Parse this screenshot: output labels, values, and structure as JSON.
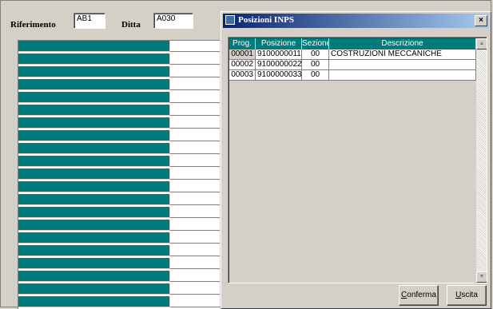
{
  "header": {
    "riferimento_label": "Riferimento",
    "riferimento_value": "AB1",
    "ditta_label": "Ditta",
    "ditta_value": "A030"
  },
  "dialog": {
    "title": "Posizioni INPS",
    "close_glyph": "×",
    "columns": [
      "Prog.",
      "Posizione",
      "Sezione",
      "Descrizione"
    ],
    "rows": [
      {
        "prog": "00001",
        "posizione": "9100000011",
        "sezione": "00",
        "descrizione": "COSTRUZIONI MECCANICHE"
      },
      {
        "prog": "00002",
        "posizione": "9100000022",
        "sezione": "00",
        "descrizione": ""
      },
      {
        "prog": "00003",
        "posizione": "9100000033",
        "sezione": "00",
        "descrizione": ""
      }
    ],
    "scroll_up_glyph": "▲",
    "scroll_down_glyph": "▼",
    "buttons": {
      "confirm_accel": "C",
      "confirm_rest": "onferma",
      "exit_accel": "U",
      "exit_rest": "scita"
    }
  }
}
